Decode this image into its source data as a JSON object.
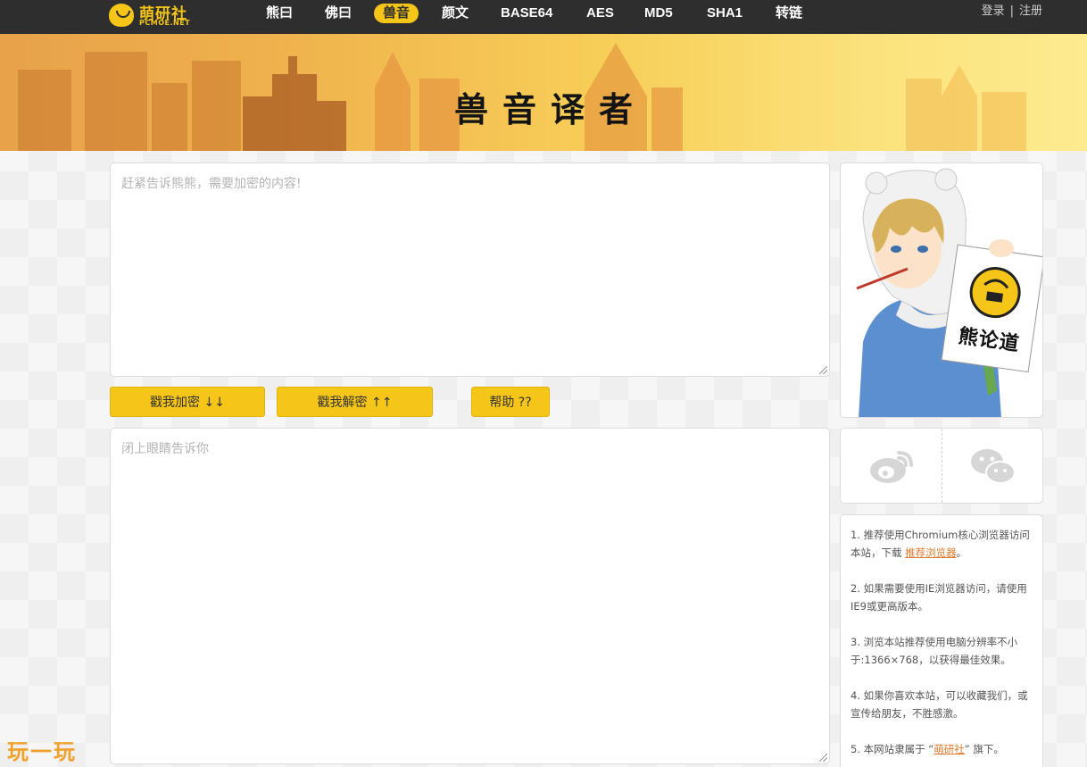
{
  "nav": {
    "logo_name": "萌研社",
    "logo_sub": "PCMOE.NET",
    "items": [
      {
        "label": "熊曰"
      },
      {
        "label": "佛曰"
      },
      {
        "label": "兽音"
      },
      {
        "label": "颜文"
      },
      {
        "label": "BASE64"
      },
      {
        "label": "AES"
      },
      {
        "label": "MD5"
      },
      {
        "label": "SHA1"
      },
      {
        "label": "转链"
      }
    ],
    "active_index": 2,
    "login": "登录",
    "separator": "|",
    "register": "注册"
  },
  "banner": {
    "title": "兽音译者"
  },
  "input_box": {
    "placeholder": "赶紧告诉熊熊，需要加密的内容!",
    "value": ""
  },
  "buttons": {
    "encrypt": "戳我加密 ↓↓",
    "decrypt": "戳我解密 ↑↑",
    "help": "帮助 ??"
  },
  "output_box": {
    "placeholder": "闭上眼睛告诉你",
    "value": ""
  },
  "sidebar": {
    "poster_text": "熊论道",
    "share": [
      {
        "icon": "weibo-icon"
      },
      {
        "icon": "wechat-icon"
      }
    ],
    "notices": [
      {
        "text": "1. 推荐使用Chromium核心浏览器访问本站，下载 ",
        "link": "推荐浏览器",
        "after": "。"
      },
      {
        "text": "2. 如果需要使用IE浏览器访问，请使用IE9或更高版本。"
      },
      {
        "text": "3. 浏览本站推荐使用电脑分辨率不小于:1366×768，以获得最佳效果。"
      },
      {
        "text": "4. 如果你喜欢本站，可以收藏我们，或宣传给朋友，不胜感激。"
      },
      {
        "text": "5. 本网站隶属于 “",
        "link": "萌研社",
        "after": "” 旗下。"
      }
    ]
  },
  "watermark": "玩一玩",
  "colors": {
    "accent": "#f5c518",
    "nav_bg": "#2e2e2e",
    "link": "#e07a2e"
  }
}
